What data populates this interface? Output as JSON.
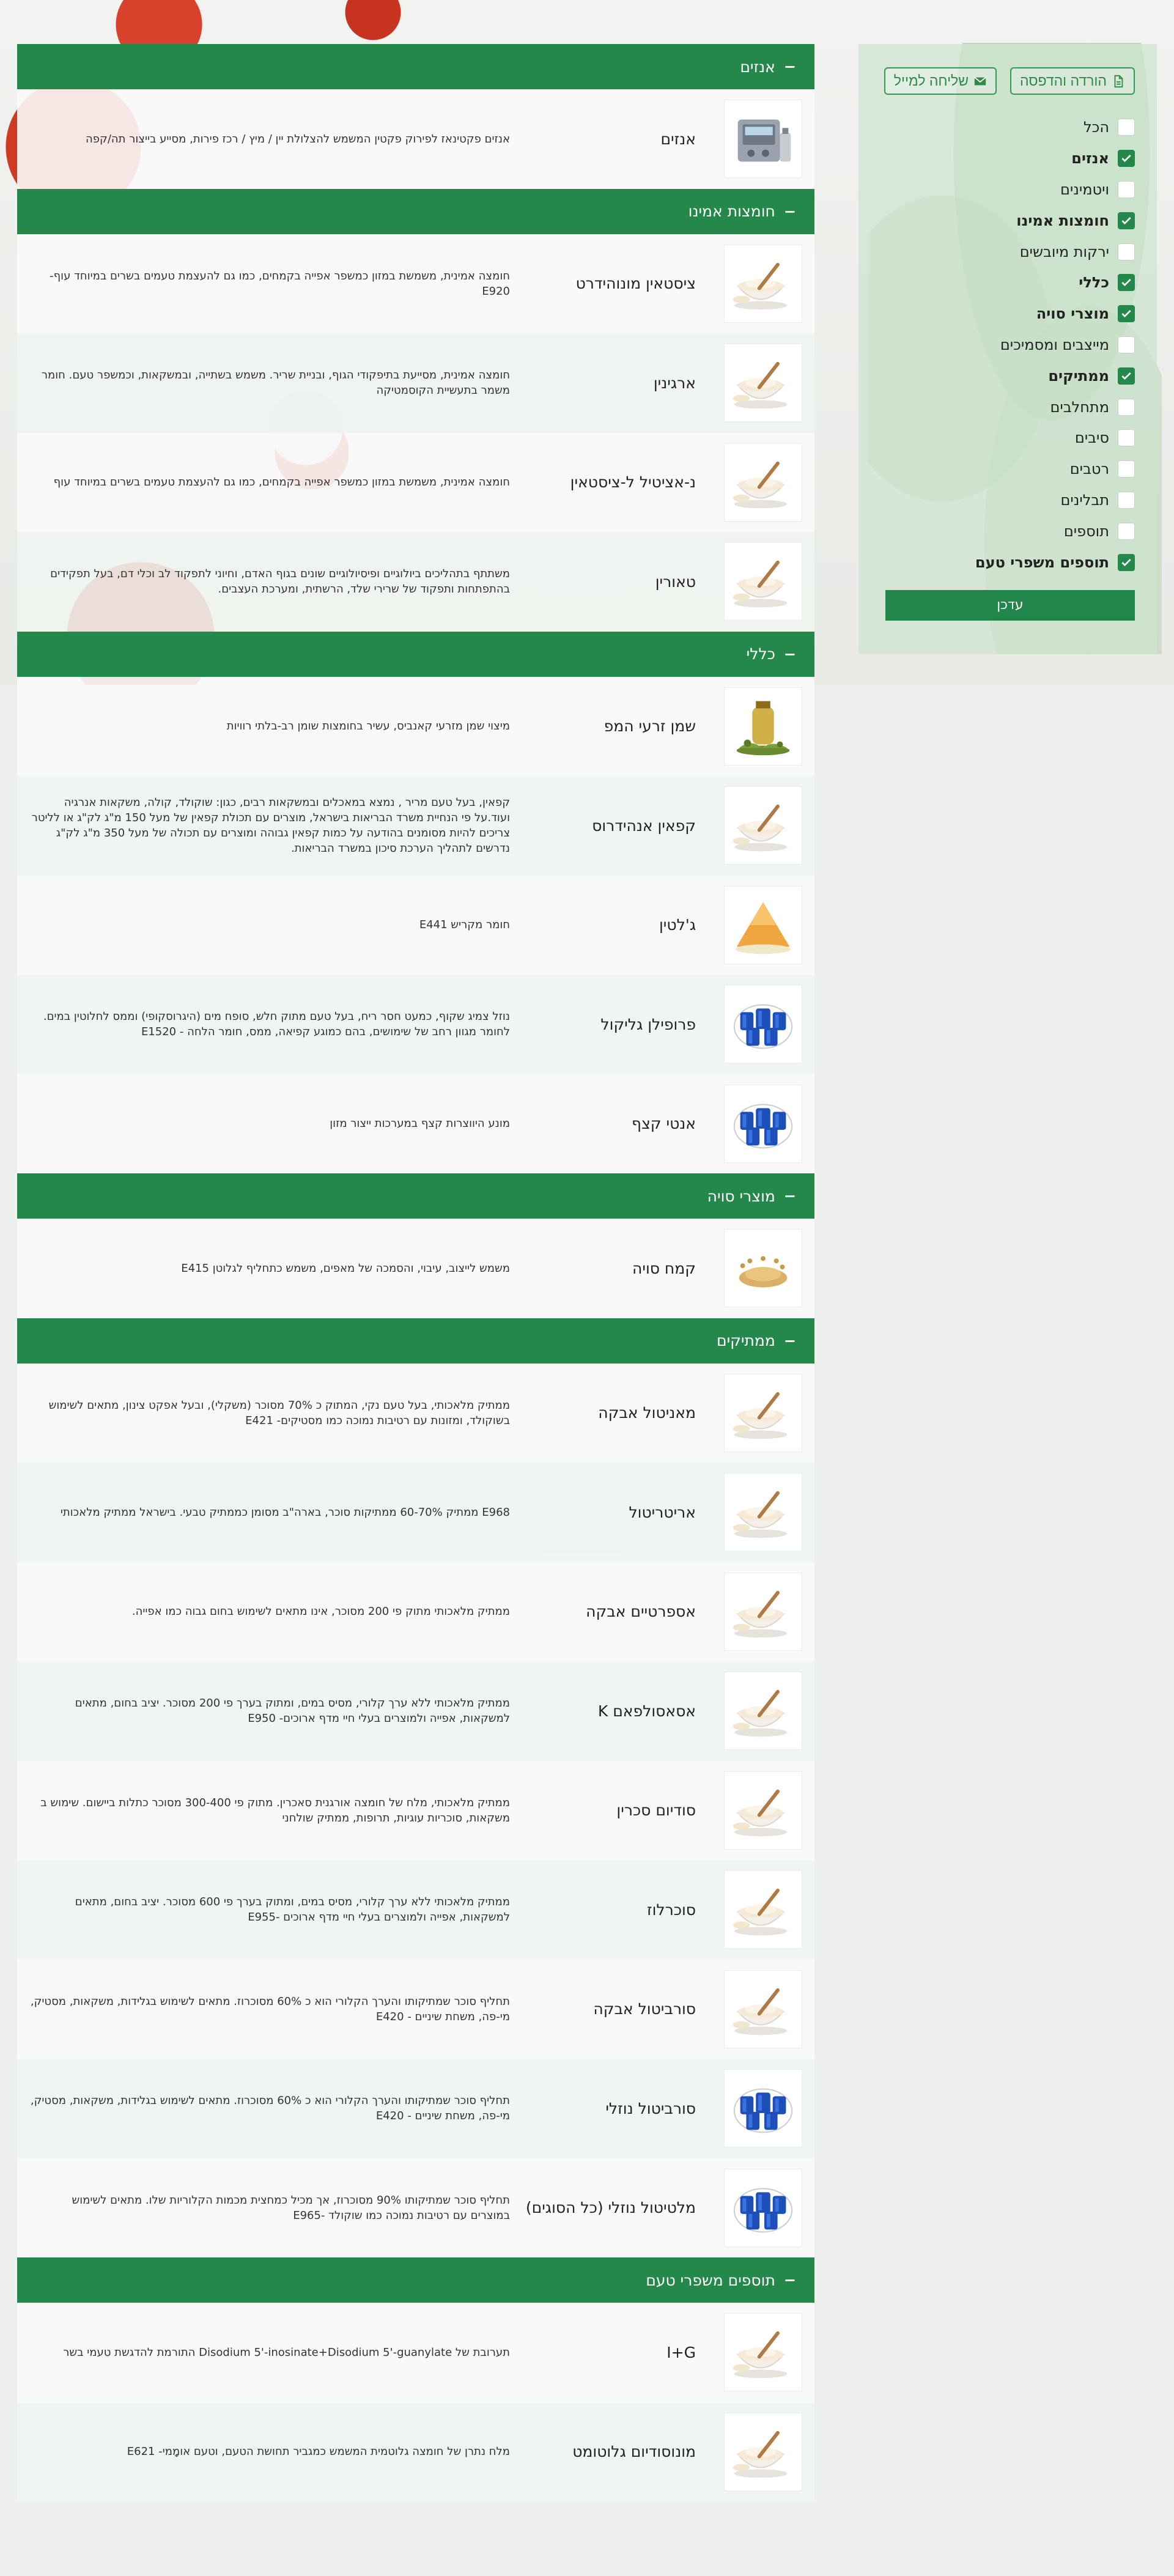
{
  "header_buttons": {
    "download": "הורדה והדפסה",
    "email": "שליחה למייל"
  },
  "filters": [
    {
      "label": "הכל",
      "checked": false
    },
    {
      "label": "אנזים",
      "checked": true
    },
    {
      "label": "ויטמינים",
      "checked": false
    },
    {
      "label": "חומצות אמינו",
      "checked": true
    },
    {
      "label": "ירקות מיובשים",
      "checked": false
    },
    {
      "label": "כללי",
      "checked": true
    },
    {
      "label": "מוצרי סויה",
      "checked": true
    },
    {
      "label": "מייצבים ומסמיכים",
      "checked": false
    },
    {
      "label": "ממתיקים",
      "checked": true
    },
    {
      "label": "מתחלבים",
      "checked": false
    },
    {
      "label": "סיבים",
      "checked": false
    },
    {
      "label": "רטבים",
      "checked": false
    },
    {
      "label": "תבלינים",
      "checked": false
    },
    {
      "label": "תוספים",
      "checked": false
    },
    {
      "label": "תוספים משפרי טעם",
      "checked": true
    }
  ],
  "update_button": "עדכן",
  "categories": [
    {
      "title": "אנזים",
      "products": [
        {
          "name": "אנזים",
          "desc": "אנזים פקטינאז לפירוק פקטין המשמש להצלולת יין / מיץ / רכז פירות, מסייע בייצור תה/קפה",
          "img": "machine"
        }
      ]
    },
    {
      "title": "חומצות אמינו",
      "products": [
        {
          "name": "ציסטאין מונוהידרט",
          "desc": "חומצה אמינית, משמשת במזון כמשפר אפייה בקמחים, כמו גם להעצמת טעמים בשרים במיוחד עוף- E920",
          "img": "powder"
        },
        {
          "name": "ארגינין",
          "desc": "חומצה אמינית, מסייעת בתיפקודי הגוף, ובניית שריר. משמש בשתייה, ובמשקאות, וכמשפר טעם. חומר משמר בתעשיית הקוסמטיקה",
          "img": "powder"
        },
        {
          "name": "נ-אציטיל ל-ציסטאין",
          "desc": "חומצה אמינית, משמשת במזון כמשפר אפייה בקמחים, כמו גם להעצמת טעמים בשרים במיוחד עוף",
          "img": "powder"
        },
        {
          "name": "טאורין",
          "desc": "משתתף בתהליכים ביולוגיים ופיסיולוגיים שונים בגוף האדם, וחיוני לתפקוד לב וכלי דם, בעל תפקידים בהתפתחות ותפקוד של שרירי שלד, הרשתית, ומערכת העצבים.",
          "img": "powder"
        }
      ]
    },
    {
      "title": "כללי",
      "products": [
        {
          "name": "שמן זרעי המפ",
          "desc": "מיצוי שמן מזרעי קאנביס, עשיר בחומצות שומן רב-בלתי רוויות",
          "img": "oil"
        },
        {
          "name": "קפאין אנהידרוס",
          "desc": "קפאין, בעל טעם מריר , נמצא במאכלים ובמשקאות רבים, כגון: שוקולד, קולה, משקאות אנרגיה ועוד.על פי הנחיית משרד הבריאות בישראל, מוצרים עם תכולת קפאין של מעל 150 מ\"ג לק\"ג או לליטר צריכים להיות מסומנים בהודעה על כמות קפאין גבוהה ומוצרים עם תכולה של מעל 350 מ\"ג לק\"ג נדרשים לתהליך הערכת סיכון במשרד הבריאות.",
          "img": "powder"
        },
        {
          "name": "ג'לטין",
          "desc": "חומר מקריש E441",
          "img": "gelatin"
        },
        {
          "name": "פרופילן גליקול",
          "desc": "נוזל צמיג שקוף, כמעט חסר ריח, בעל טעם מתוק חלש, סופח מים (היגרוסקופי) וממס לחלוטין במים. לחומר מגוון רחב של שימושים, בהם כמוגע קפיאה, ממס, חומר הלחה - E1520",
          "img": "barrels"
        },
        {
          "name": "אנטי קצף",
          "desc": "מונע היווצרות קצף במערכות ייצור מזון",
          "img": "barrels"
        }
      ]
    },
    {
      "title": "מוצרי סויה",
      "products": [
        {
          "name": "קמח סויה",
          "desc": "משמש לייצוב, עיבוי, והסמכה של מאפים, משמש כתחליף לגלוטן E415",
          "img": "soy"
        }
      ]
    },
    {
      "title": "ממתיקים",
      "products": [
        {
          "name": "מאניטול אבקה",
          "desc": "ממתיק מלאכותי, בעל טעם נקי, המתוק כ 70% מסוכר (משקלי), ובעל אפקט צינון, מתאים לשימוש בשוקולד, ומזונות עם רטיבות נמוכה כמו מסטיקים- E421",
          "img": "powder"
        },
        {
          "name": "אריטריטול",
          "desc": "E968 ממתיק 60-70% ממתיקות סוכר, בארה\"ב מסומן כממתיק טבעי. בישראל ממתיק מלאכותי",
          "img": "powder"
        },
        {
          "name": "אספרטיים אבקה",
          "desc": "ממתיק מלאכותי מתוק פי 200 מסוכר, אינו מתאים לשימוש בחום גבוה כמו אפייה.",
          "img": "powder"
        },
        {
          "name": "אסאסולפאם K",
          "desc": "ממתיק מלאכותי ללא ערך קלורי, מסיס במים, ומתוק בערך פי 200 מסוכר. יציב בחום, מתאים למשקאות, אפייה ולמוצרים בעלי חיי מדף ארוכים- E950",
          "img": "powder"
        },
        {
          "name": "סודיום סכרין",
          "desc": "ממתיק מלאכותי, מלח של חומצה אורגנית סאכרין. מתוק פי 300-400 מסוכר כתלות ביישום. שימוש ב משקאות, סוכריות עוגיות, תרופות, ממתיק שולחני",
          "img": "powder"
        },
        {
          "name": "סוכרלוז",
          "desc": "ממתיק מלאכותי ללא ערך קלורי, מסיס במים, ומתוק בערך פי 600 מסוכר. יציב בחום, מתאים למשקאות, אפייה ולמוצרים בעלי חיי מדף ארוכים -E955",
          "img": "powder"
        },
        {
          "name": "סורביטול אבקה",
          "desc": "תחליף סוכר שמתיקותו והערך הקלורי הוא כ 60% מסוכרוז. מתאים לשימוש בגלידות, משקאות, מסטיק, מי-פה, משחת שיניים - E420",
          "img": "powder"
        },
        {
          "name": "סורביטול נוזלי",
          "desc": "תחליף סוכר שמתיקותו והערך הקלורי הוא כ 60% מסוכרוז. מתאים לשימוש בגלידות, משקאות, מסטיק, מי-פה, משחת שיניים - E420",
          "img": "barrels"
        },
        {
          "name": "מלטיטול נוזלי (כל הסוגים)",
          "desc": "תחליף סוכר שמתיקותו 90% מסוכרוז, אך מכיל כמחצית מכמות הקלוריות שלו. מתאים לשימוש במוצרים עם רטיבות נמוכה כמו שוקולד -E965",
          "img": "barrels"
        }
      ]
    },
    {
      "title": "תוספים משפרי טעם",
      "products": [
        {
          "name": "I+G",
          "desc": "תערובת של Disodium 5'-inosinate+Disodium 5'-guanylate התורמת להדגשת טעמי בשר",
          "img": "powder"
        },
        {
          "name": "מונוסודיום גלוטומט",
          "desc": "מלח נתרן של חומצה גלוטמית המשמש כמגביר תחושת הטעם, וטעם אומָמי- E621",
          "img": "powder"
        }
      ]
    }
  ],
  "icons": {
    "download": "file-icon",
    "email": "envelope-icon",
    "check": "check-icon"
  },
  "colors": {
    "primary_green": "#23884a",
    "header_text": "#ffffff"
  }
}
